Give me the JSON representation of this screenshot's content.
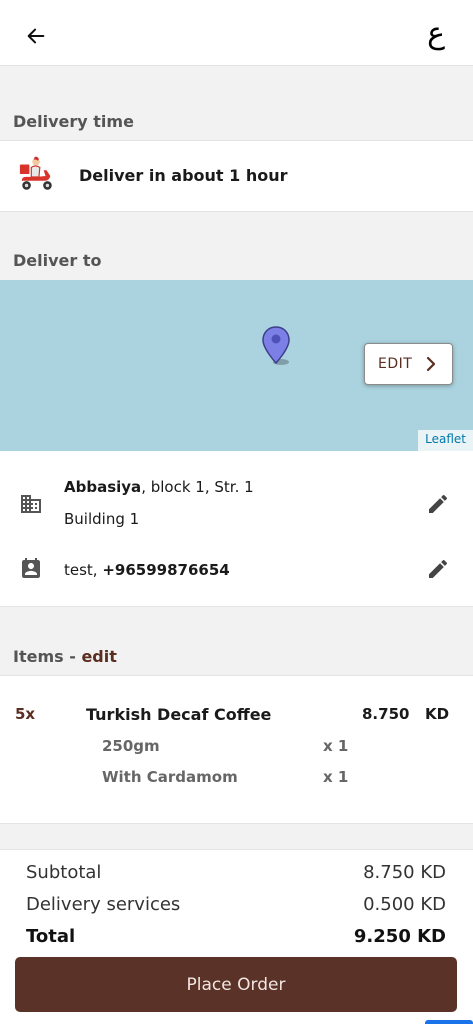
{
  "header": {
    "back_icon": "arrow-left-icon",
    "language_label": "ع"
  },
  "delivery_time": {
    "section_label": "Delivery time",
    "icon": "delivery-scooter-icon",
    "text": "Deliver in about 1 hour"
  },
  "deliver_to": {
    "section_label": "Deliver to",
    "map": {
      "background_color": "#aad3df",
      "pin_icon": "map-pin-icon",
      "pin_color": "#7b7fe6",
      "edit_label": "EDIT",
      "attribution": "Leaflet"
    },
    "address": {
      "icon": "building-icon",
      "area": "Abbasiya",
      "details": ", block 1, Str. 1",
      "line2": "Building 1"
    },
    "contact": {
      "icon": "contact-card-icon",
      "name": "test, ",
      "phone": "+96599876654"
    }
  },
  "items": {
    "section_label": "Items - ",
    "edit_label": "edit",
    "list": [
      {
        "quantity": "5x",
        "name": "Turkish Decaf Coffee",
        "price": "8.750",
        "currency": "KD",
        "options": [
          {
            "name": "250gm",
            "qty": "x 1"
          },
          {
            "name": "With Cardamom",
            "qty": "x 1"
          }
        ]
      }
    ]
  },
  "summary": {
    "subtotal_label": "Subtotal",
    "subtotal_value": "8.750 KD",
    "delivery_label": "Delivery services",
    "delivery_value": "0.500 KD",
    "total_label": "Total",
    "total_value": "9.250 KD"
  },
  "place_order_label": "Place Order",
  "colors": {
    "accent": "#5a2e20",
    "button": "#5b3227",
    "map_water": "#aad3df"
  }
}
